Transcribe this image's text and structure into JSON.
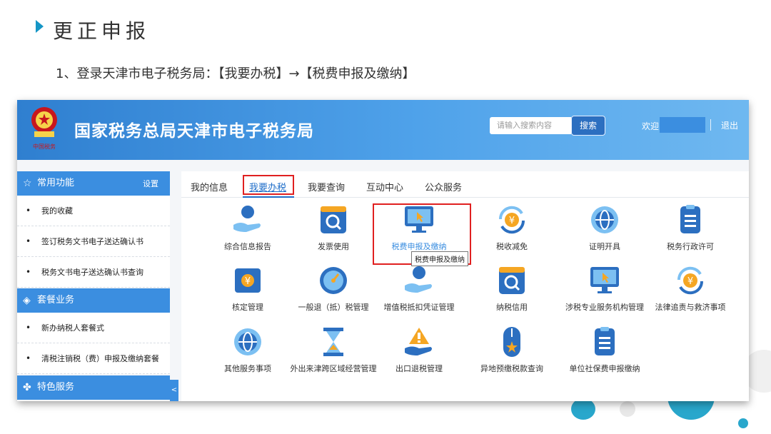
{
  "slide": {
    "title": "更正申报",
    "step": "1、登录天津市电子税务局：【我要办税】→【税费申报及缴纳】"
  },
  "header": {
    "site_title": "国家税务总局天津市电子税务局",
    "search_placeholder": "请输入搜索内容",
    "search_button": "搜索",
    "welcome": "欢迎",
    "logout": "退出"
  },
  "sidebar": {
    "common": {
      "title": "常用功能",
      "settings": "设置",
      "icon": "star-icon"
    },
    "common_items": [
      "我的收藏",
      "签订税务文书电子送达确认书",
      "税务文书电子送达确认书查询"
    ],
    "package": {
      "title": "套餐业务",
      "icon": "layers-icon"
    },
    "package_items": [
      "新办纳税人套餐式",
      "清税注销税（费）申报及缴纳套餐"
    ],
    "special": {
      "title": "特色服务",
      "icon": "clover-icon"
    },
    "collapse": "<"
  },
  "tabs": [
    "我的信息",
    "我要办税",
    "我要查询",
    "互动中心",
    "公众服务"
  ],
  "active_tab": "我要办税",
  "tooltip": "税费申报及缴纳",
  "services": [
    [
      {
        "label": "综合信息报告",
        "icon": "hand-money-icon"
      },
      {
        "label": "发票使用",
        "icon": "invoice-search-icon"
      },
      {
        "label": "税费申报及缴纳",
        "icon": "monitor-cursor-icon"
      },
      {
        "label": "税收减免",
        "icon": "yen-refresh-icon"
      },
      {
        "label": "证明开具",
        "icon": "globe-icon"
      },
      {
        "label": "税务行政许可",
        "icon": "clipboard-icon"
      }
    ],
    [
      {
        "label": "核定管理",
        "icon": "yen-ticket-icon"
      },
      {
        "label": "一般退（抵）税管理",
        "icon": "gauge-icon"
      },
      {
        "label": "增值税抵扣凭证管理",
        "icon": "hand-money-icon"
      },
      {
        "label": "纳税信用",
        "icon": "invoice-search-icon"
      },
      {
        "label": "涉税专业服务机构管理",
        "icon": "monitor-cursor-icon"
      },
      {
        "label": "法律追责与救济事项",
        "icon": "yen-refresh-icon"
      }
    ],
    [
      {
        "label": "其他服务事项",
        "icon": "globe-icon"
      },
      {
        "label": "外出来津跨区域经营管理",
        "icon": "hourglass-icon"
      },
      {
        "label": "出口退税管理",
        "icon": "warning-hand-icon"
      },
      {
        "label": "异地预缴税款查询",
        "icon": "mouse-star-icon"
      },
      {
        "label": "单位社保费申报缴纳",
        "icon": "clipboard-icon"
      }
    ]
  ],
  "colors": {
    "accent": "#3b8ee0",
    "highlight": "#e02020",
    "marker": "#1596c6",
    "icon_dark": "#2c6fc0",
    "icon_light": "#7cc0f2",
    "icon_orange": "#f5a623"
  }
}
